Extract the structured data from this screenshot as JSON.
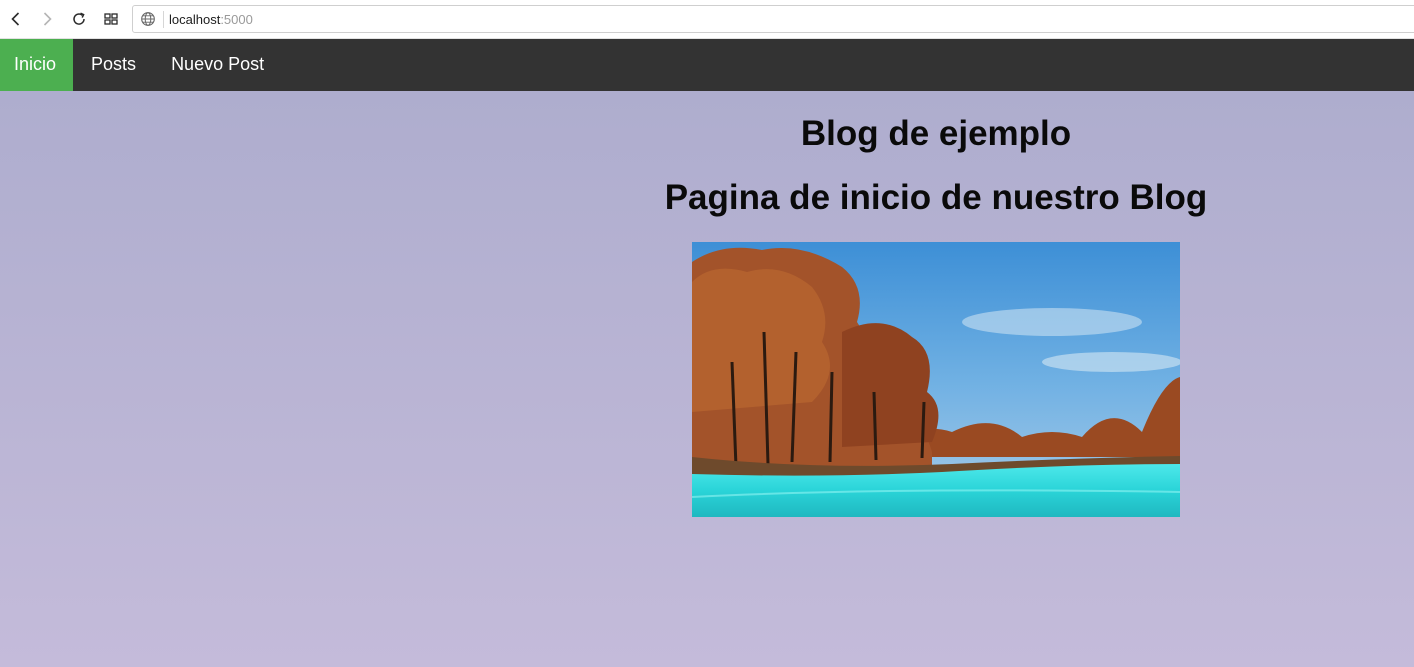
{
  "browser": {
    "url_host": "localhost",
    "url_port": ":5000"
  },
  "nav": {
    "items": [
      {
        "label": "Inicio",
        "active": true
      },
      {
        "label": "Posts",
        "active": false
      },
      {
        "label": "Nuevo Post",
        "active": false
      }
    ],
    "active_color": "#4caf50",
    "bar_color": "#333333"
  },
  "page": {
    "title": "Blog de ejemplo",
    "subtitle": "Pagina de inicio de nuestro Blog",
    "image": {
      "subject": "autumn-lake-landscape"
    }
  }
}
